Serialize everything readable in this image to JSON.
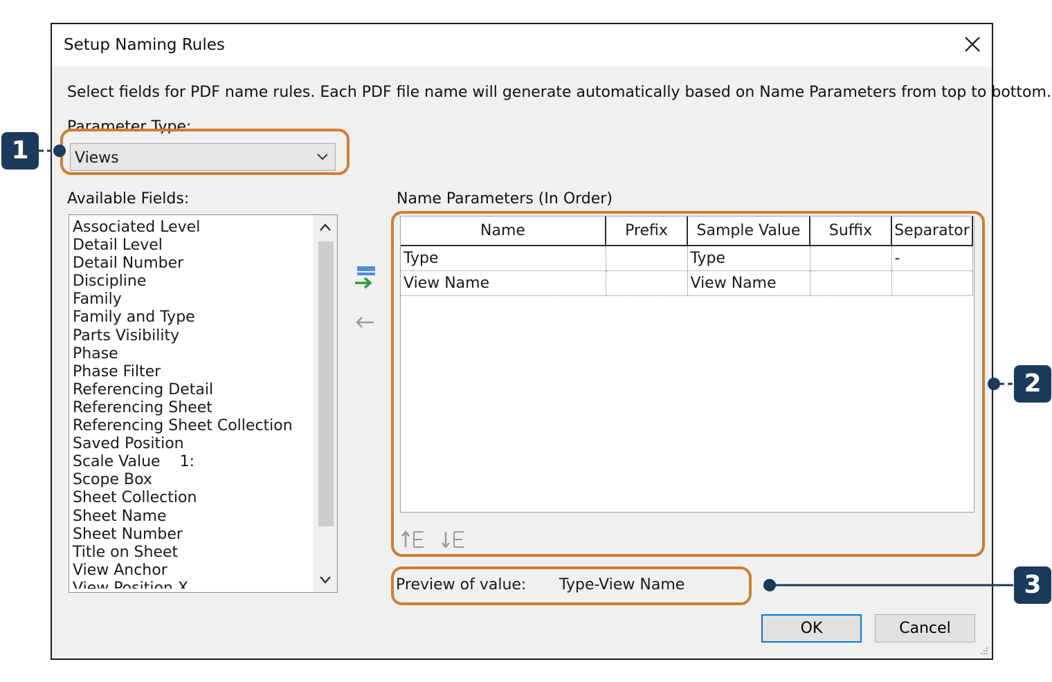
{
  "dialog": {
    "title": "Setup Naming Rules",
    "description": "Select fields for PDF name rules. Each PDF file name will generate automatically based on Name Parameters from top to bottom."
  },
  "parameter_type": {
    "label": "Parameter Type:",
    "selected": "Views"
  },
  "available_fields": {
    "label": "Available Fields:",
    "items": [
      "Associated Level",
      "Detail Level",
      "Detail Number",
      "Discipline",
      "Family",
      "Family and Type",
      "Parts Visibility",
      "Phase",
      "Phase Filter",
      "Referencing Detail",
      "Referencing Sheet",
      "Referencing Sheet Collection",
      "Saved Position",
      "Scale Value    1:",
      "Scope Box",
      "Sheet Collection",
      "Sheet Name",
      "Sheet Number",
      "Title on Sheet",
      "View Anchor",
      "View Position X"
    ]
  },
  "name_parameters": {
    "label": "Name Parameters (In Order)",
    "columns": [
      "Name",
      "Prefix",
      "Sample Value",
      "Suffix",
      "Separator"
    ],
    "rows": [
      [
        "Type",
        "",
        "Type",
        "",
        "-"
      ],
      [
        "View Name",
        "",
        "View Name",
        "",
        ""
      ]
    ]
  },
  "preview": {
    "label": "Preview of value:",
    "value": "Type-View Name"
  },
  "buttons": {
    "ok": "OK",
    "cancel": "Cancel"
  },
  "callouts": {
    "one": "1",
    "two": "2",
    "three": "3"
  },
  "colors": {
    "callout_border": "#d27d2d",
    "badge": "#1b3a5c",
    "ok_focus": "#0078d7"
  }
}
